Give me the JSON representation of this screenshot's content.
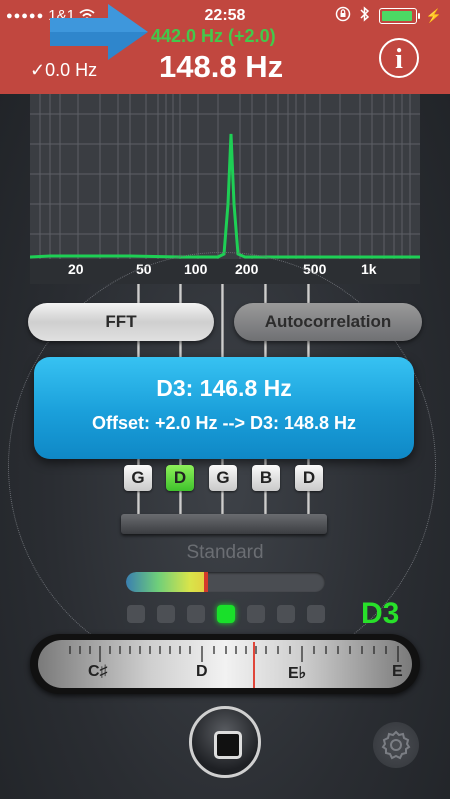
{
  "status_bar": {
    "signal": "●●●●●",
    "carrier": "1&1",
    "time": "22:58"
  },
  "header": {
    "freq_small": "442.0 Hz (+2.0)",
    "ref_freq": "✓0.0 Hz",
    "freq_big": "148.8 Hz",
    "info_icon": "i"
  },
  "spectrum": {
    "x_labels": [
      "20",
      "50",
      "100",
      "200",
      "500",
      "1k"
    ]
  },
  "mode_buttons": {
    "fft": "FFT",
    "autocorrelation": "Autocorrelation"
  },
  "note_display": {
    "main": "D3: 146.8 Hz",
    "offset": "Offset: +2.0 Hz --> D3: 148.8 Hz"
  },
  "strings": {
    "keys": [
      "G",
      "D",
      "G",
      "B",
      "D"
    ],
    "active_index": 1
  },
  "tuning": {
    "name": "Standard",
    "level": 0.4,
    "peak": 0.39
  },
  "cents_leds": {
    "count": 7,
    "active_index": 3
  },
  "detected_note": "D3",
  "scale_labels": [
    "C♯",
    "D",
    "E♭",
    "E"
  ],
  "colors": {
    "header_bg": "#c1473f",
    "accent_green": "#28e02a",
    "note_box_blue": "#1a9fda",
    "spectrum_line": "#1ecf55",
    "needle": "#e0463a"
  },
  "icons": {
    "arrow": "blue-arrow-icon",
    "info": "info-icon",
    "home": "stop-square-icon",
    "settings": "gear-icon"
  }
}
